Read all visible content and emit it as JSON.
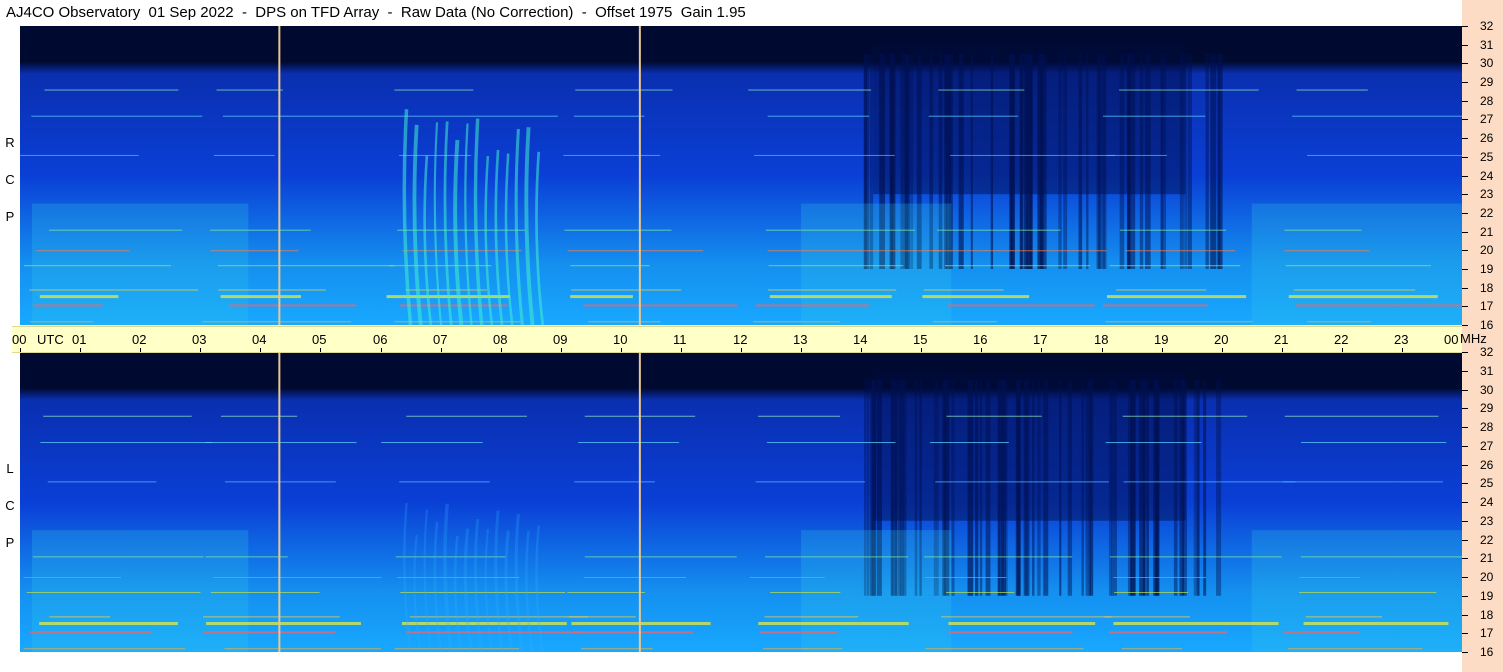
{
  "header": {
    "title": "AJ4CO Observatory  01 Sep 2022  -  DPS on TFD Array  -  Raw Data (No Correction)  -  Offset 1975  Gain 1.95"
  },
  "colors": {
    "background": "#ffffff",
    "freq_axis_bg": "#fcdcc4",
    "time_axis_bg": "#ffffc8",
    "spectrogram_deep": "#000a30",
    "spectrogram_mid": "#0a3fd6",
    "spectrogram_light": "#18a8ff",
    "spectrogram_hot": "#f2f030",
    "marker_line": "#e8c890"
  },
  "panels": [
    {
      "id": "rcp",
      "label_letters": [
        "R",
        "C",
        "P"
      ]
    },
    {
      "id": "lcp",
      "label_letters": [
        "L",
        "C",
        "P"
      ]
    }
  ],
  "time_axis": {
    "hours": [
      "00",
      "01",
      "02",
      "03",
      "04",
      "05",
      "06",
      "07",
      "08",
      "09",
      "10",
      "11",
      "12",
      "13",
      "14",
      "15",
      "16",
      "17",
      "18",
      "19",
      "20",
      "21",
      "22",
      "23",
      "00"
    ],
    "utc_label": "UTC",
    "unit_label": "MHz"
  },
  "chart_data": {
    "type": "heatmap",
    "title": "AJ4CO Observatory  01 Sep 2022  -  DPS on TFD Array  -  Raw Data (No Correction)  -  Offset 1975  Gain 1.95",
    "x_axis": {
      "unit": "UTC",
      "range": [
        0,
        24
      ],
      "ticks": [
        "00",
        "01",
        "02",
        "03",
        "04",
        "05",
        "06",
        "07",
        "08",
        "09",
        "10",
        "11",
        "12",
        "13",
        "14",
        "15",
        "16",
        "17",
        "18",
        "19",
        "20",
        "21",
        "22",
        "23",
        "00"
      ]
    },
    "y_axis": {
      "unit": "MHz",
      "range": [
        16,
        32
      ],
      "ticks": [
        16,
        17,
        18,
        19,
        20,
        21,
        22,
        23,
        24,
        25,
        26,
        27,
        28,
        29,
        30,
        31,
        32
      ]
    },
    "panels": [
      "RCP",
      "LCP"
    ],
    "vertical_markers_utc": [
      4.3,
      10.3
    ],
    "burst_region_utc": [
      6.5,
      8.7
    ]
  }
}
